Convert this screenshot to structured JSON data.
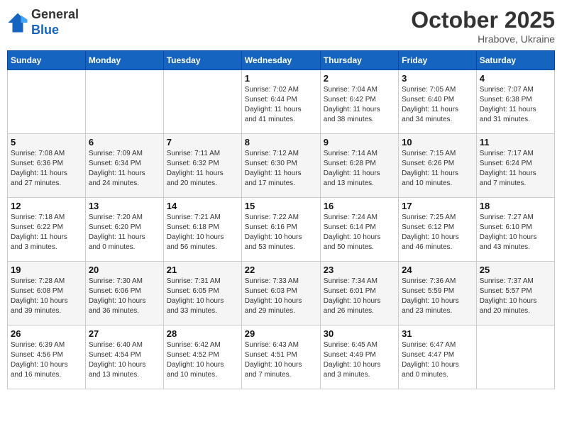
{
  "logo": {
    "general": "General",
    "blue": "Blue"
  },
  "header": {
    "month": "October 2025",
    "location": "Hrabove, Ukraine"
  },
  "days_of_week": [
    "Sunday",
    "Monday",
    "Tuesday",
    "Wednesday",
    "Thursday",
    "Friday",
    "Saturday"
  ],
  "weeks": [
    [
      {
        "day": "",
        "info": ""
      },
      {
        "day": "",
        "info": ""
      },
      {
        "day": "",
        "info": ""
      },
      {
        "day": "1",
        "info": "Sunrise: 7:02 AM\nSunset: 6:44 PM\nDaylight: 11 hours\nand 41 minutes."
      },
      {
        "day": "2",
        "info": "Sunrise: 7:04 AM\nSunset: 6:42 PM\nDaylight: 11 hours\nand 38 minutes."
      },
      {
        "day": "3",
        "info": "Sunrise: 7:05 AM\nSunset: 6:40 PM\nDaylight: 11 hours\nand 34 minutes."
      },
      {
        "day": "4",
        "info": "Sunrise: 7:07 AM\nSunset: 6:38 PM\nDaylight: 11 hours\nand 31 minutes."
      }
    ],
    [
      {
        "day": "5",
        "info": "Sunrise: 7:08 AM\nSunset: 6:36 PM\nDaylight: 11 hours\nand 27 minutes."
      },
      {
        "day": "6",
        "info": "Sunrise: 7:09 AM\nSunset: 6:34 PM\nDaylight: 11 hours\nand 24 minutes."
      },
      {
        "day": "7",
        "info": "Sunrise: 7:11 AM\nSunset: 6:32 PM\nDaylight: 11 hours\nand 20 minutes."
      },
      {
        "day": "8",
        "info": "Sunrise: 7:12 AM\nSunset: 6:30 PM\nDaylight: 11 hours\nand 17 minutes."
      },
      {
        "day": "9",
        "info": "Sunrise: 7:14 AM\nSunset: 6:28 PM\nDaylight: 11 hours\nand 13 minutes."
      },
      {
        "day": "10",
        "info": "Sunrise: 7:15 AM\nSunset: 6:26 PM\nDaylight: 11 hours\nand 10 minutes."
      },
      {
        "day": "11",
        "info": "Sunrise: 7:17 AM\nSunset: 6:24 PM\nDaylight: 11 hours\nand 7 minutes."
      }
    ],
    [
      {
        "day": "12",
        "info": "Sunrise: 7:18 AM\nSunset: 6:22 PM\nDaylight: 11 hours\nand 3 minutes."
      },
      {
        "day": "13",
        "info": "Sunrise: 7:20 AM\nSunset: 6:20 PM\nDaylight: 11 hours\nand 0 minutes."
      },
      {
        "day": "14",
        "info": "Sunrise: 7:21 AM\nSunset: 6:18 PM\nDaylight: 10 hours\nand 56 minutes."
      },
      {
        "day": "15",
        "info": "Sunrise: 7:22 AM\nSunset: 6:16 PM\nDaylight: 10 hours\nand 53 minutes."
      },
      {
        "day": "16",
        "info": "Sunrise: 7:24 AM\nSunset: 6:14 PM\nDaylight: 10 hours\nand 50 minutes."
      },
      {
        "day": "17",
        "info": "Sunrise: 7:25 AM\nSunset: 6:12 PM\nDaylight: 10 hours\nand 46 minutes."
      },
      {
        "day": "18",
        "info": "Sunrise: 7:27 AM\nSunset: 6:10 PM\nDaylight: 10 hours\nand 43 minutes."
      }
    ],
    [
      {
        "day": "19",
        "info": "Sunrise: 7:28 AM\nSunset: 6:08 PM\nDaylight: 10 hours\nand 39 minutes."
      },
      {
        "day": "20",
        "info": "Sunrise: 7:30 AM\nSunset: 6:06 PM\nDaylight: 10 hours\nand 36 minutes."
      },
      {
        "day": "21",
        "info": "Sunrise: 7:31 AM\nSunset: 6:05 PM\nDaylight: 10 hours\nand 33 minutes."
      },
      {
        "day": "22",
        "info": "Sunrise: 7:33 AM\nSunset: 6:03 PM\nDaylight: 10 hours\nand 29 minutes."
      },
      {
        "day": "23",
        "info": "Sunrise: 7:34 AM\nSunset: 6:01 PM\nDaylight: 10 hours\nand 26 minutes."
      },
      {
        "day": "24",
        "info": "Sunrise: 7:36 AM\nSunset: 5:59 PM\nDaylight: 10 hours\nand 23 minutes."
      },
      {
        "day": "25",
        "info": "Sunrise: 7:37 AM\nSunset: 5:57 PM\nDaylight: 10 hours\nand 20 minutes."
      }
    ],
    [
      {
        "day": "26",
        "info": "Sunrise: 6:39 AM\nSunset: 4:56 PM\nDaylight: 10 hours\nand 16 minutes."
      },
      {
        "day": "27",
        "info": "Sunrise: 6:40 AM\nSunset: 4:54 PM\nDaylight: 10 hours\nand 13 minutes."
      },
      {
        "day": "28",
        "info": "Sunrise: 6:42 AM\nSunset: 4:52 PM\nDaylight: 10 hours\nand 10 minutes."
      },
      {
        "day": "29",
        "info": "Sunrise: 6:43 AM\nSunset: 4:51 PM\nDaylight: 10 hours\nand 7 minutes."
      },
      {
        "day": "30",
        "info": "Sunrise: 6:45 AM\nSunset: 4:49 PM\nDaylight: 10 hours\nand 3 minutes."
      },
      {
        "day": "31",
        "info": "Sunrise: 6:47 AM\nSunset: 4:47 PM\nDaylight: 10 hours\nand 0 minutes."
      },
      {
        "day": "",
        "info": ""
      }
    ]
  ]
}
